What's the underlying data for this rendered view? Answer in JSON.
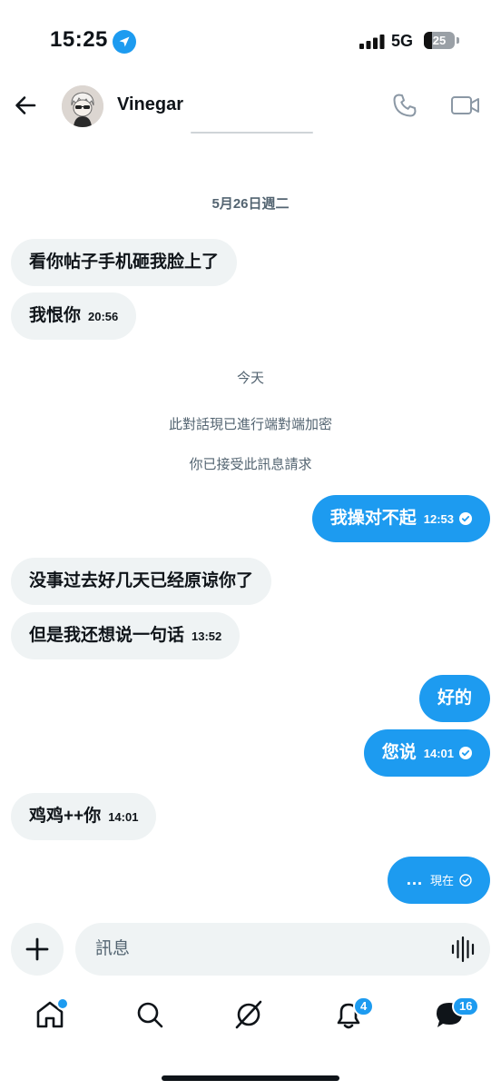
{
  "status_bar": {
    "time": "15:25",
    "network": "5G",
    "battery": "25"
  },
  "header": {
    "name": "Vinegar"
  },
  "date_separator": "5月26日週二",
  "system": {
    "today": "今天",
    "encryption": "此對話現已進行端對端加密",
    "accepted": "你已接受此訊息請求"
  },
  "messages": [
    {
      "side": "received",
      "text": "看你帖子手机砸我脸上了"
    },
    {
      "side": "received",
      "text": "我恨你",
      "time": "20:56"
    },
    {
      "side": "sent",
      "text": "我操对不起",
      "time": "12:53"
    },
    {
      "side": "received",
      "text": "没事过去好几天已经原谅你了"
    },
    {
      "side": "received",
      "text": "但是我还想说一句话",
      "time": "13:52"
    },
    {
      "side": "sent",
      "text": "好的"
    },
    {
      "side": "sent",
      "text": "您说",
      "time": "14:01"
    },
    {
      "side": "received",
      "text": "鸡鸡++你",
      "time": "14:01"
    },
    {
      "side": "sent",
      "text": "…",
      "time": "現在"
    }
  ],
  "composer": {
    "placeholder": "訊息"
  },
  "nav": {
    "notifications_badge": "4",
    "messages_badge": "16"
  },
  "colors": {
    "accent": "#1d9bf0",
    "received_bubble": "#eff3f4"
  },
  "icons": [
    "location-arrow-icon",
    "signal-icon",
    "back-arrow-icon",
    "phone-icon",
    "video-icon",
    "check-circle-icon",
    "plus-icon",
    "voice-wave-icon",
    "home-icon",
    "search-icon",
    "grok-icon",
    "bell-icon",
    "messages-icon"
  ]
}
